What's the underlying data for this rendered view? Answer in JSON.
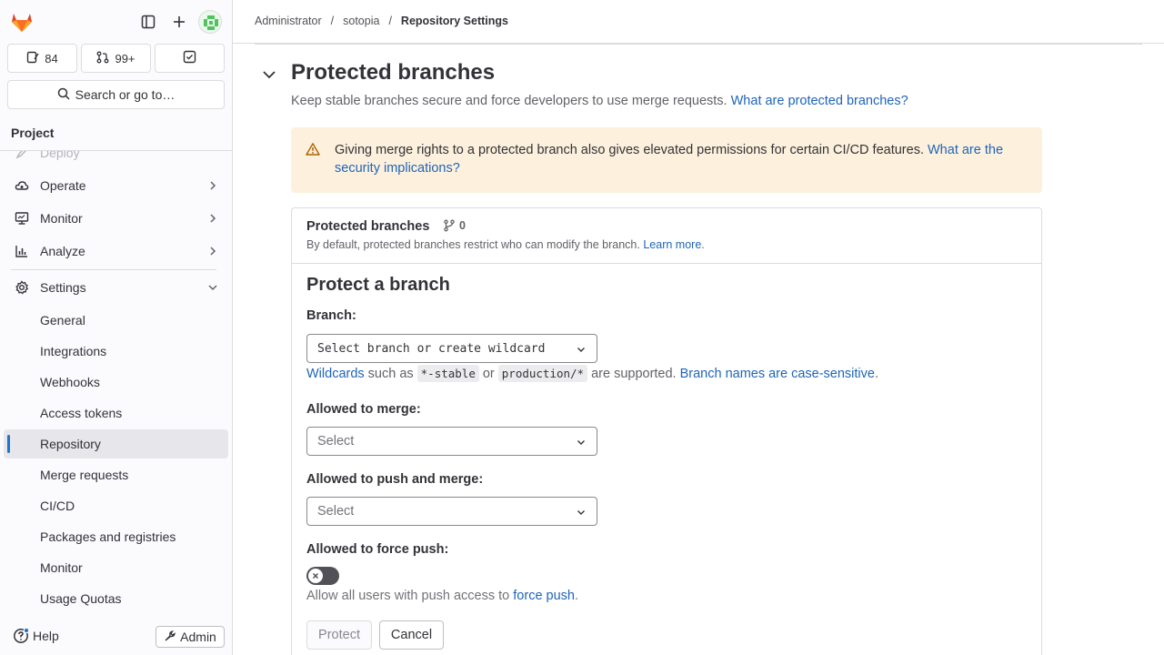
{
  "sidebar": {
    "counts": {
      "issues": "84",
      "merge_requests": "99+"
    },
    "search_label": "Search or go to…",
    "project_label": "Project",
    "partial_item": "Deploy",
    "items": [
      {
        "label": "Operate"
      },
      {
        "label": "Monitor"
      },
      {
        "label": "Analyze"
      },
      {
        "label": "Settings"
      }
    ],
    "settings_sub": [
      {
        "label": "General"
      },
      {
        "label": "Integrations"
      },
      {
        "label": "Webhooks"
      },
      {
        "label": "Access tokens"
      },
      {
        "label": "Repository"
      },
      {
        "label": "Merge requests"
      },
      {
        "label": "CI/CD"
      },
      {
        "label": "Packages and registries"
      },
      {
        "label": "Monitor"
      },
      {
        "label": "Usage Quotas"
      }
    ],
    "help_label": "Help",
    "admin_label": "Admin"
  },
  "breadcrumb": [
    "Administrator",
    "sotopia",
    "Repository Settings"
  ],
  "section": {
    "title": "Protected branches",
    "description": "Keep stable branches secure and force developers to use merge requests.",
    "description_link": "What are protected branches?"
  },
  "alert": {
    "text": "Giving merge rights to a protected branch also gives elevated permissions for certain CI/CD features.",
    "link": "What are the security implications?"
  },
  "card": {
    "title": "Protected branches",
    "count": "0",
    "description": "By default, protected branches restrict who can modify the branch.",
    "learn_more": "Learn more",
    "learn_more_suffix": "."
  },
  "form": {
    "heading": "Protect a branch",
    "branch_label": "Branch:",
    "branch_value": "Select branch or create wildcard",
    "wildcards_link": "Wildcards",
    "wildcards_text1": "such as",
    "wildcard_example1": "*-stable",
    "wildcards_or": "or",
    "wildcard_example2": "production/*",
    "wildcards_text2": "are supported.",
    "case_link": "Branch names are case-sensitive",
    "case_suffix": ".",
    "merge_label": "Allowed to merge:",
    "merge_value": "Select",
    "push_label": "Allowed to push and merge:",
    "push_value": "Select",
    "force_label": "Allowed to force push:",
    "force_enabled": false,
    "force_help": "Allow all users with push access to",
    "force_link": "force push",
    "force_suffix": ".",
    "protect_button": "Protect",
    "cancel_button": "Cancel"
  },
  "colors": {
    "link": "#1f64b8",
    "alert_bg": "#fdf1dd",
    "active_bar": "#1f75cb"
  }
}
